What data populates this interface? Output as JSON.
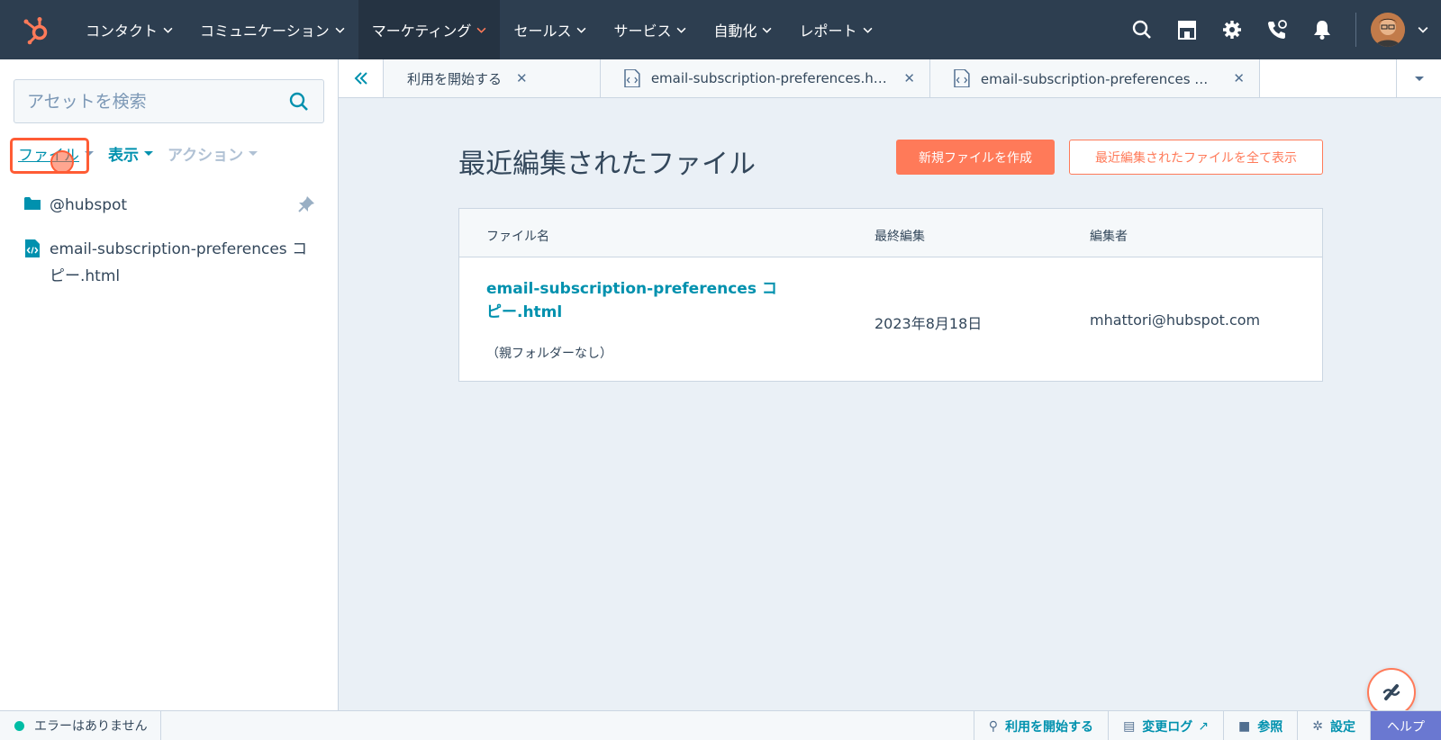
{
  "nav": {
    "items": [
      {
        "label": "コンタクト"
      },
      {
        "label": "コミュニケーション"
      },
      {
        "label": "マーケティング",
        "active": true
      },
      {
        "label": "セールス"
      },
      {
        "label": "サービス"
      },
      {
        "label": "自動化"
      },
      {
        "label": "レポート"
      }
    ],
    "right_icons": [
      "search-icon",
      "marketplace-icon",
      "settings-icon",
      "calling-icon",
      "notifications-icon"
    ],
    "accent": "#ff7a59",
    "background": "#2d3e50"
  },
  "sidebar": {
    "search_placeholder": "アセットを検索",
    "toolbar": {
      "file_label": "ファイル",
      "view_label": "表示",
      "action_label": "アクション"
    },
    "tree": {
      "folder_label": "@hubspot",
      "file_label": "email-subscription-preferences コピー.html"
    }
  },
  "tabs": [
    {
      "label": "利用を開始する",
      "icon": "none"
    },
    {
      "label": "email-subscription-preferences.ht...",
      "icon": "code-file-icon"
    },
    {
      "label": "email-subscription-preferences コ...",
      "icon": "code-file-icon"
    }
  ],
  "main": {
    "title": "最近編集されたファイル",
    "create_button": "新規ファイルを作成",
    "view_all_button": "最近編集されたファイルを全て表示",
    "table": {
      "headers": [
        "ファイル名",
        "最終編集",
        "編集者"
      ],
      "rows": [
        {
          "file_name": "email-subscription-preferences コピー.html",
          "folder": "（親フォルダーなし）",
          "last_edited": "2023年8月18日",
          "editor": "mhattori@hubspot.com"
        }
      ]
    }
  },
  "statusbar": {
    "status_text": "エラーはありません",
    "get_started": "利用を開始する",
    "changelog": "変更ログ",
    "reference": "参照",
    "settings": "設定",
    "help": "ヘルプ"
  }
}
